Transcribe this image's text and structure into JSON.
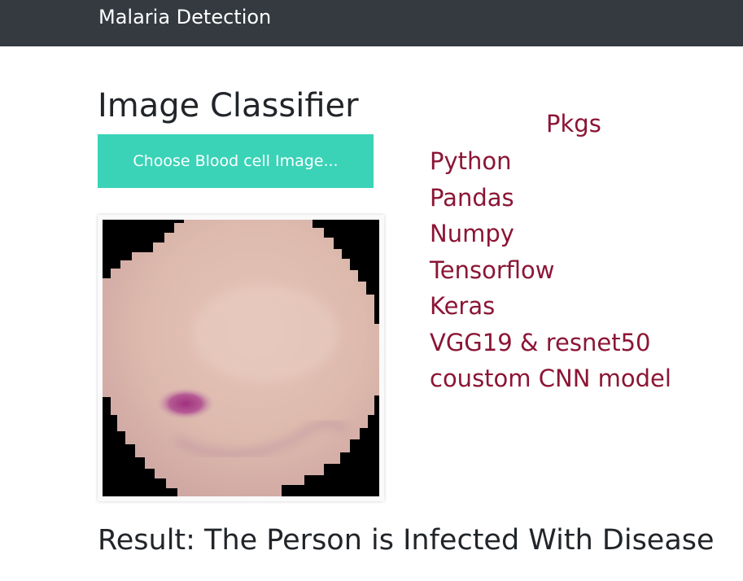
{
  "navbar": {
    "brand": "Malaria Detection"
  },
  "main": {
    "title": "Image Classifier",
    "upload_button_label": "Choose Blood cell Image...",
    "result_text": "Result: The Person is Infected With Disease"
  },
  "sidebar": {
    "heading": "Pkgs",
    "packages": [
      "Python",
      "Pandas",
      "Numpy",
      "Tensorflow",
      "Keras",
      "VGG19 & resnet50",
      "coustom CNN model"
    ]
  },
  "colors": {
    "navbar_bg": "#343a40",
    "button_bg": "#3ad3b7",
    "pkg_text": "#8b1535"
  }
}
